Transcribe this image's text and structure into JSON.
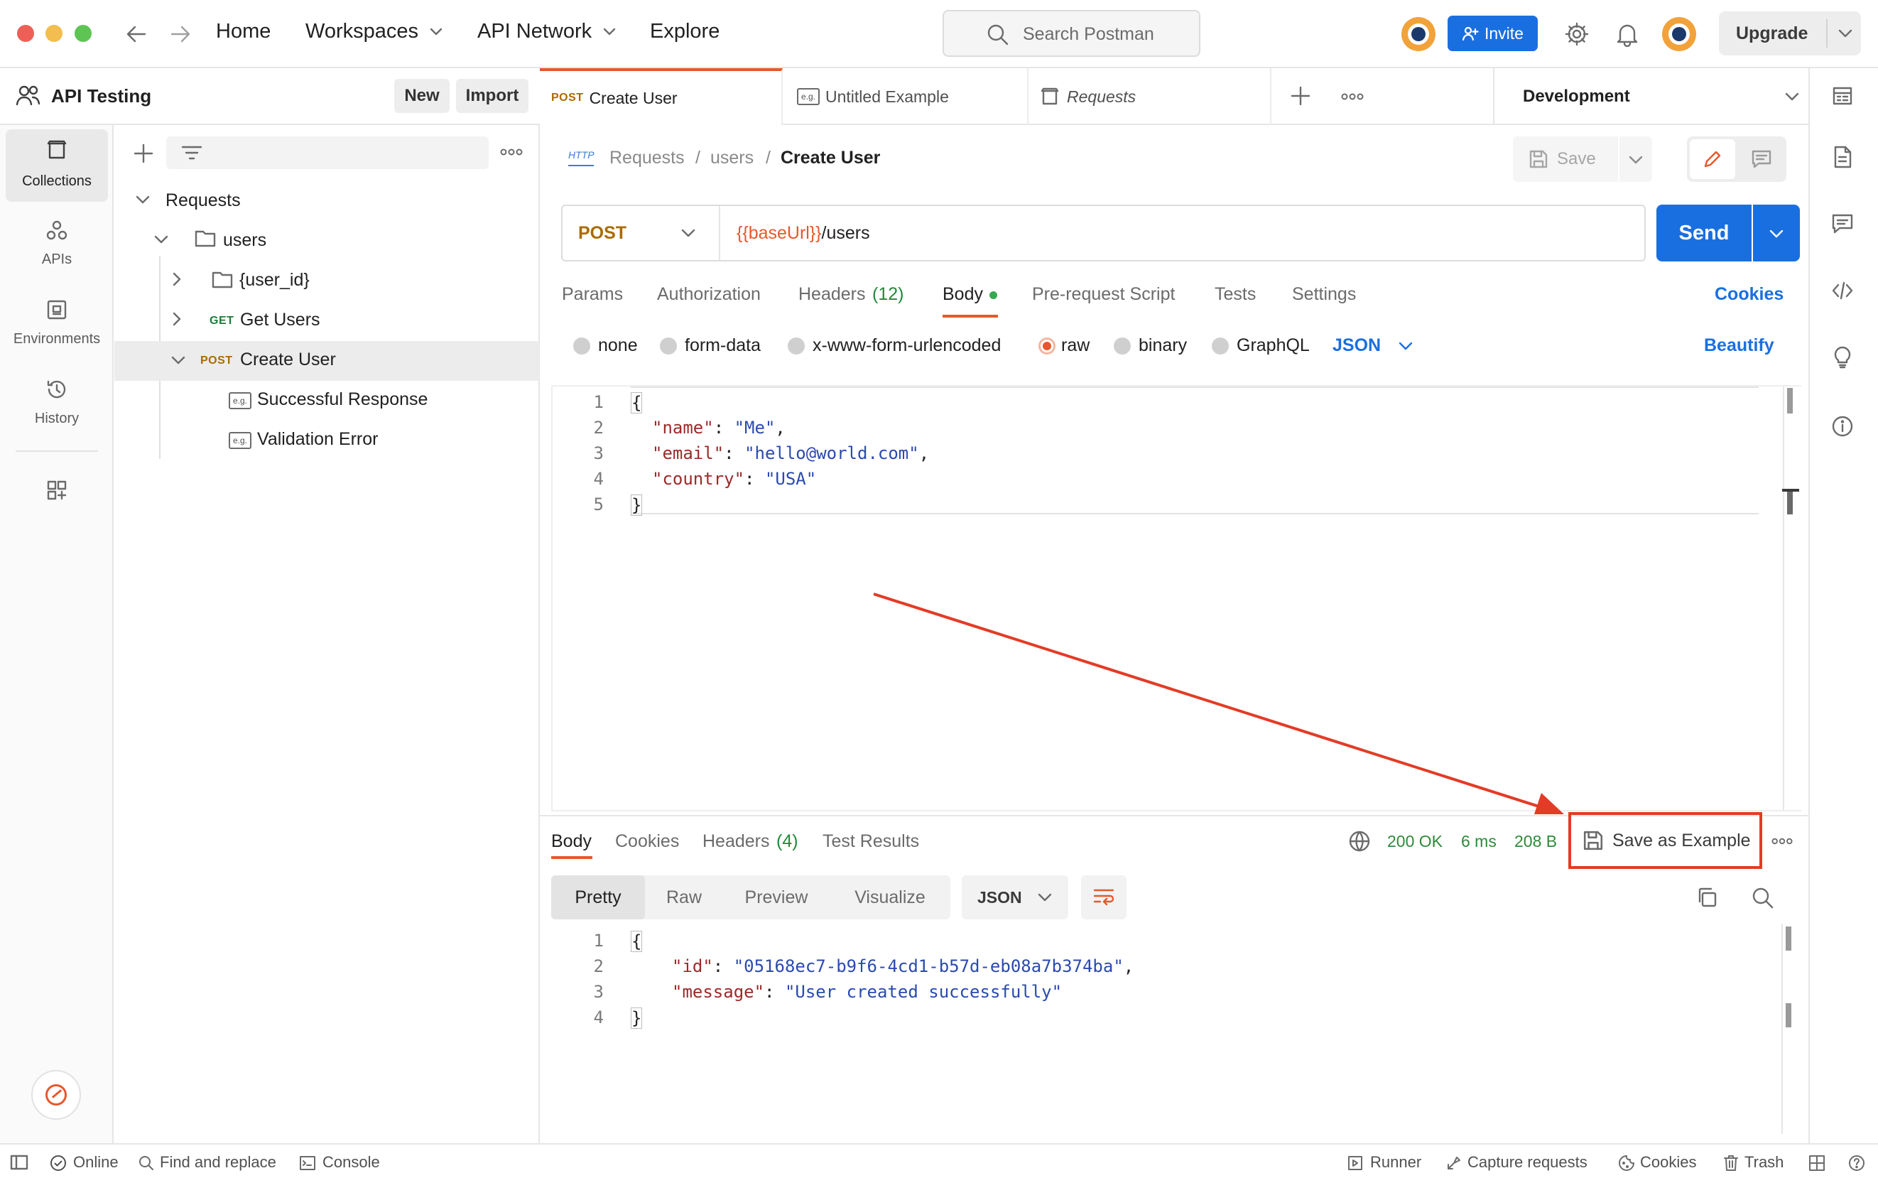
{
  "nav": {
    "home": "Home",
    "workspaces": "Workspaces",
    "api_network": "API Network",
    "explore": "Explore",
    "search_placeholder": "Search Postman",
    "invite": "Invite",
    "upgrade": "Upgrade"
  },
  "workspace": {
    "name": "API Testing",
    "new_label": "New",
    "import_label": "Import"
  },
  "rail": {
    "items": [
      {
        "label": "Collections",
        "icon": "collections-icon"
      },
      {
        "label": "APIs",
        "icon": "apis-icon"
      },
      {
        "label": "Environments",
        "icon": "environments-icon"
      },
      {
        "label": "History",
        "icon": "history-icon"
      }
    ]
  },
  "tree": {
    "root": "Requests",
    "folder": "users",
    "subfolder": "{user_id}",
    "get_method": "GET",
    "get_label": "Get Users",
    "post_method": "POST",
    "post_label": "Create User",
    "example1": "Successful Response",
    "example2": "Validation Error",
    "example_badge": "e.g."
  },
  "tabs": [
    {
      "method": "POST",
      "label": "Create User"
    },
    {
      "label": "Untitled Example",
      "badge": "e.g."
    },
    {
      "label": "Requests"
    }
  ],
  "environment": "Development",
  "breadcrumb": {
    "badge": "HTTP",
    "part1": "Requests",
    "sep": "/",
    "part2": "users",
    "current": "Create User"
  },
  "save_label": "Save",
  "request": {
    "method": "POST",
    "url_var": "{{baseUrl}}",
    "url_path": "/users",
    "send": "Send"
  },
  "request_tabs": {
    "params": "Params",
    "authorization": "Authorization",
    "headers": "Headers",
    "headers_count": "(12)",
    "body": "Body",
    "prerequest": "Pre-request Script",
    "tests": "Tests",
    "settings": "Settings",
    "cookies": "Cookies"
  },
  "body_types": {
    "none": "none",
    "form_data": "form-data",
    "urlencoded": "x-www-form-urlencoded",
    "raw": "raw",
    "binary": "binary",
    "graphql": "GraphQL",
    "format": "JSON",
    "beautify": "Beautify"
  },
  "request_body": {
    "line_numbers": [
      "1",
      "2",
      "3",
      "4",
      "5"
    ],
    "open": "{",
    "close": "}",
    "lines": [
      {
        "key": "\"name\"",
        "value": "\"Me\"",
        "comma": ","
      },
      {
        "key": "\"email\"",
        "value": "\"hello@world.com\"",
        "comma": ","
      },
      {
        "key": "\"country\"",
        "value": "\"USA\"",
        "comma": ""
      }
    ]
  },
  "response_tabs": {
    "body": "Body",
    "cookies": "Cookies",
    "headers": "Headers",
    "headers_count": "(4)",
    "test_results": "Test Results"
  },
  "response_meta": {
    "status": "200 OK",
    "time": "6 ms",
    "size": "208 B",
    "save_example": "Save as Example"
  },
  "response_view": {
    "pretty": "Pretty",
    "raw": "Raw",
    "preview": "Preview",
    "visualize": "Visualize",
    "format": "JSON"
  },
  "response_body": {
    "line_numbers": [
      "1",
      "2",
      "3",
      "4"
    ],
    "open": "{",
    "close": "}",
    "lines": [
      {
        "key": "\"id\"",
        "value": "\"05168ec7-b9f6-4cd1-b57d-eb08a7b374ba\"",
        "comma": ","
      },
      {
        "key": "\"message\"",
        "value": "\"User created successfully\"",
        "comma": ""
      }
    ]
  },
  "status_bar": {
    "online": "Online",
    "find_replace": "Find and replace",
    "console": "Console",
    "runner": "Runner",
    "capture": "Capture requests",
    "cookies": "Cookies",
    "trash": "Trash"
  },
  "colors": {
    "accent_orange": "#e8572b",
    "primary_blue": "#1a6fe0",
    "method_post": "#a86b00",
    "method_get": "#1f7a3a",
    "status_green": "#2f8a3a",
    "highlight_red": "#e33b26"
  }
}
